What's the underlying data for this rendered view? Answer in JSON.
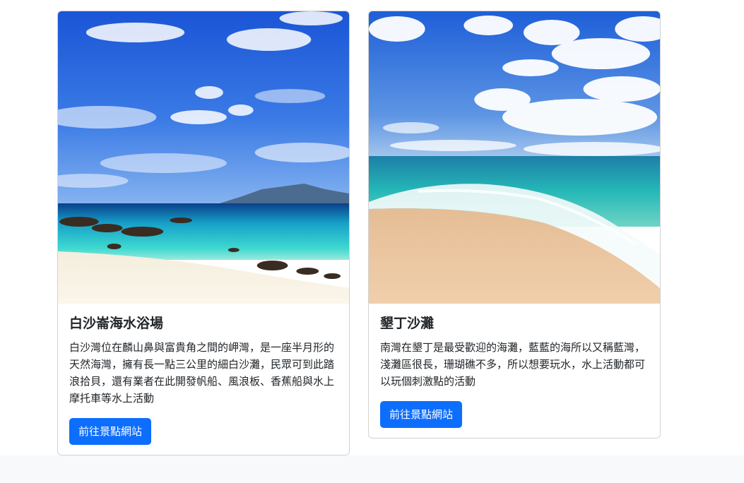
{
  "cards": [
    {
      "image_alt": "beach-photo-1",
      "title": "白沙崙海水浴場",
      "text": "白沙灣位在麟山鼻與富貴角之間的岬灣，是一座半月形的天然海灣，擁有長一點三公里的細白沙灘，民眾可到此踏浪拾貝，還有業者在此開發帆船、風浪板、香蕉船與水上摩托車等水上活動",
      "button_label": "前往景點網站"
    },
    {
      "image_alt": "beach-photo-2",
      "title": "墾丁沙灘",
      "text": "南灣在墾丁是最受歡迎的海灘，藍藍的海所以又稱藍灣，淺灘區很長，珊瑚礁不多，所以想要玩水，水上活動都可以玩個刺激點的活動",
      "button_label": "前往景點網站"
    }
  ],
  "colors": {
    "primary": "#0d6efd",
    "footer_bg": "#f8f9fa"
  }
}
